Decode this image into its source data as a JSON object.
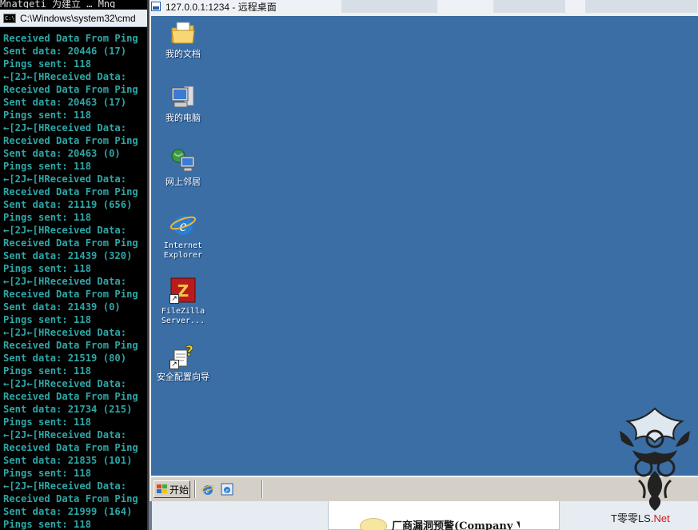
{
  "host": {
    "cmd_clipped_top": "Mnatgeti   为建立 … Mng",
    "notice_text": "厂商漏洞预警(Company V"
  },
  "cmd_window": {
    "title": "C:\\Windows\\system32\\cmd",
    "lines": [
      "Received Data From Ping",
      "Sent data: 20446 (17)",
      "Pings sent: 118",
      "←[2J←[HReceived Data:",
      "Received Data From Ping",
      "Sent data: 20463 (17)",
      "Pings sent: 118",
      "←[2J←[HReceived Data:",
      "Received Data From Ping",
      "Sent data: 20463 (0)",
      "Pings sent: 118",
      "←[2J←[HReceived Data:",
      "Received Data From Ping",
      "Sent data: 21119 (656)",
      "Pings sent: 118",
      "←[2J←[HReceived Data:",
      "Received Data From Ping",
      "Sent data: 21439 (320)",
      "Pings sent: 118",
      "←[2J←[HReceived Data:",
      "Received Data From Ping",
      "Sent data: 21439 (0)",
      "Pings sent: 118",
      "←[2J←[HReceived Data:",
      "Received Data From Ping",
      "Sent data: 21519 (80)",
      "Pings sent: 118",
      "←[2J←[HReceived Data:",
      "Received Data From Ping",
      "Sent data: 21734 (215)",
      "Pings sent: 118",
      "←[2J←[HReceived Data:",
      "Received Data From Ping",
      "Sent data: 21835 (101)",
      "Pings sent: 118",
      "←[2J←[HReceived Data:",
      "Received Data From Ping",
      "Sent data: 21999 (164)",
      "Pings sent: 118"
    ]
  },
  "rdp_window": {
    "title": "127.0.0.1:1234 - 远程桌面",
    "desktop_icons": [
      {
        "label": "我的文档",
        "icon": "my-documents-icon"
      },
      {
        "label": "我的电脑",
        "icon": "my-computer-icon"
      },
      {
        "label": "网上邻居",
        "icon": "network-places-icon"
      },
      {
        "label": "Internet\nExplorer",
        "icon": "internet-explorer-icon"
      },
      {
        "label": "FileZilla\nServer...",
        "icon": "filezilla-icon"
      },
      {
        "label": "安全配置向导",
        "icon": "security-wizard-icon"
      }
    ],
    "taskbar": {
      "start_label": "开始"
    }
  },
  "watermark": {
    "text_a": "T零零",
    "text_b": "LS.",
    "text_c": "Net"
  },
  "colors": {
    "desktop": "#3a6ea5",
    "cmd_text": "#2fa5a5",
    "taskbar": "#d4d0c8"
  }
}
